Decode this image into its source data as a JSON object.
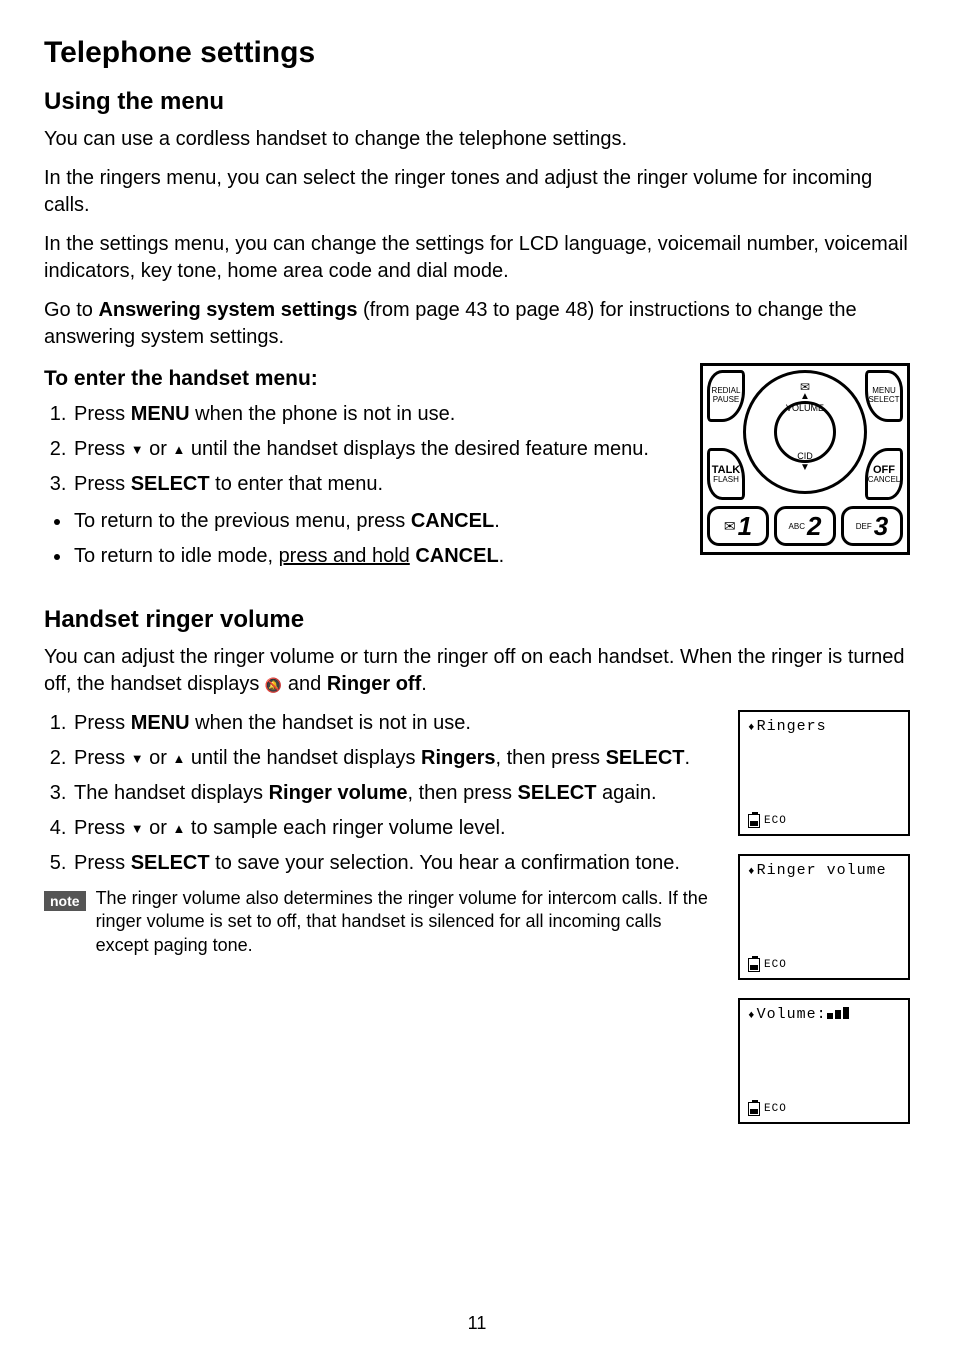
{
  "title": "Telephone settings",
  "section1": {
    "heading": "Using the menu",
    "p1": "You can use a cordless handset to change the telephone settings.",
    "p2": "In the ringers menu, you can select the ringer tones and adjust the ringer volume for incoming calls.",
    "p3": "In the settings menu, you can change the settings for LCD language, voicemail number, voicemail indicators, key tone, home area code and dial mode.",
    "p4_a": "Go to ",
    "p4_b": "Answering system settings",
    "p4_c": " (from page 43 to page 48) for instructions to change the answering system settings.",
    "sub1": "To enter the handset menu:",
    "steps": {
      "s1_a": "Press ",
      "s1_b": "MENU",
      "s1_c": " when the phone is not in use.",
      "s2_a": "Press ",
      "s2_b": " or ",
      "s2_c": " until the handset displays the desired feature menu.",
      "s3_a": "Press ",
      "s3_b": "SELECT",
      "s3_c": " to enter that menu."
    },
    "bullets": {
      "b1_a": "To return to the previous menu, press ",
      "b1_b": "CANCEL",
      "b1_c": ".",
      "b2_a": "To return to idle mode, ",
      "b2_b": "press and hold",
      "b2_c": " ",
      "b2_d": "CANCEL",
      "b2_e": "."
    }
  },
  "section2": {
    "heading": "Handset ringer volume",
    "p1_a": "You can adjust the ringer volume or turn the ringer off on each handset. When the ringer is turned off, the handset displays ",
    "p1_b": " and ",
    "p1_c": "Ringer off",
    "p1_d": ".",
    "steps": {
      "s1_a": "Press ",
      "s1_b": "MENU",
      "s1_c": " when the handset is not in use.",
      "s2_a": "Press ",
      "s2_b": " or ",
      "s2_c": " until the handset displays ",
      "s2_d": "Ringers",
      "s2_e": ", then press ",
      "s2_f": "SELECT",
      "s2_g": ".",
      "s3_a": "The handset displays ",
      "s3_b": "Ringer volume",
      "s3_c": ", then press ",
      "s3_d": "SELECT",
      "s3_e": " again.",
      "s4_a": "Press ",
      "s4_b": " or ",
      "s4_c": " to sample each ringer volume level.",
      "s5_a": "Press ",
      "s5_b": "SELECT",
      "s5_c": " to save your selection. You hear a confirmation tone."
    },
    "note_label": "note",
    "note_text": "The ringer volume also determines the ringer volume for intercom calls. If the ringer volume is set to off, that handset is silenced for all incoming calls except paging tone."
  },
  "keypad": {
    "tl1": "REDIAL",
    "tl2": "PAUSE",
    "tr1": "MENU",
    "tr2": "SELECT",
    "bl1": "TALK",
    "bl2": "FLASH",
    "br1": "OFF",
    "br2": "CANCEL",
    "center_top": "VOLUME",
    "center_bot": "CID",
    "key1_small": "",
    "key1_big": "1",
    "key2_small": "ABC",
    "key2_big": "2",
    "key3_small": "DEF",
    "key3_big": "3"
  },
  "lcd": {
    "s1": "Ringers",
    "s2": "Ringer volume",
    "s3": "Volume:",
    "eco": "ECO"
  },
  "page_number": "11"
}
